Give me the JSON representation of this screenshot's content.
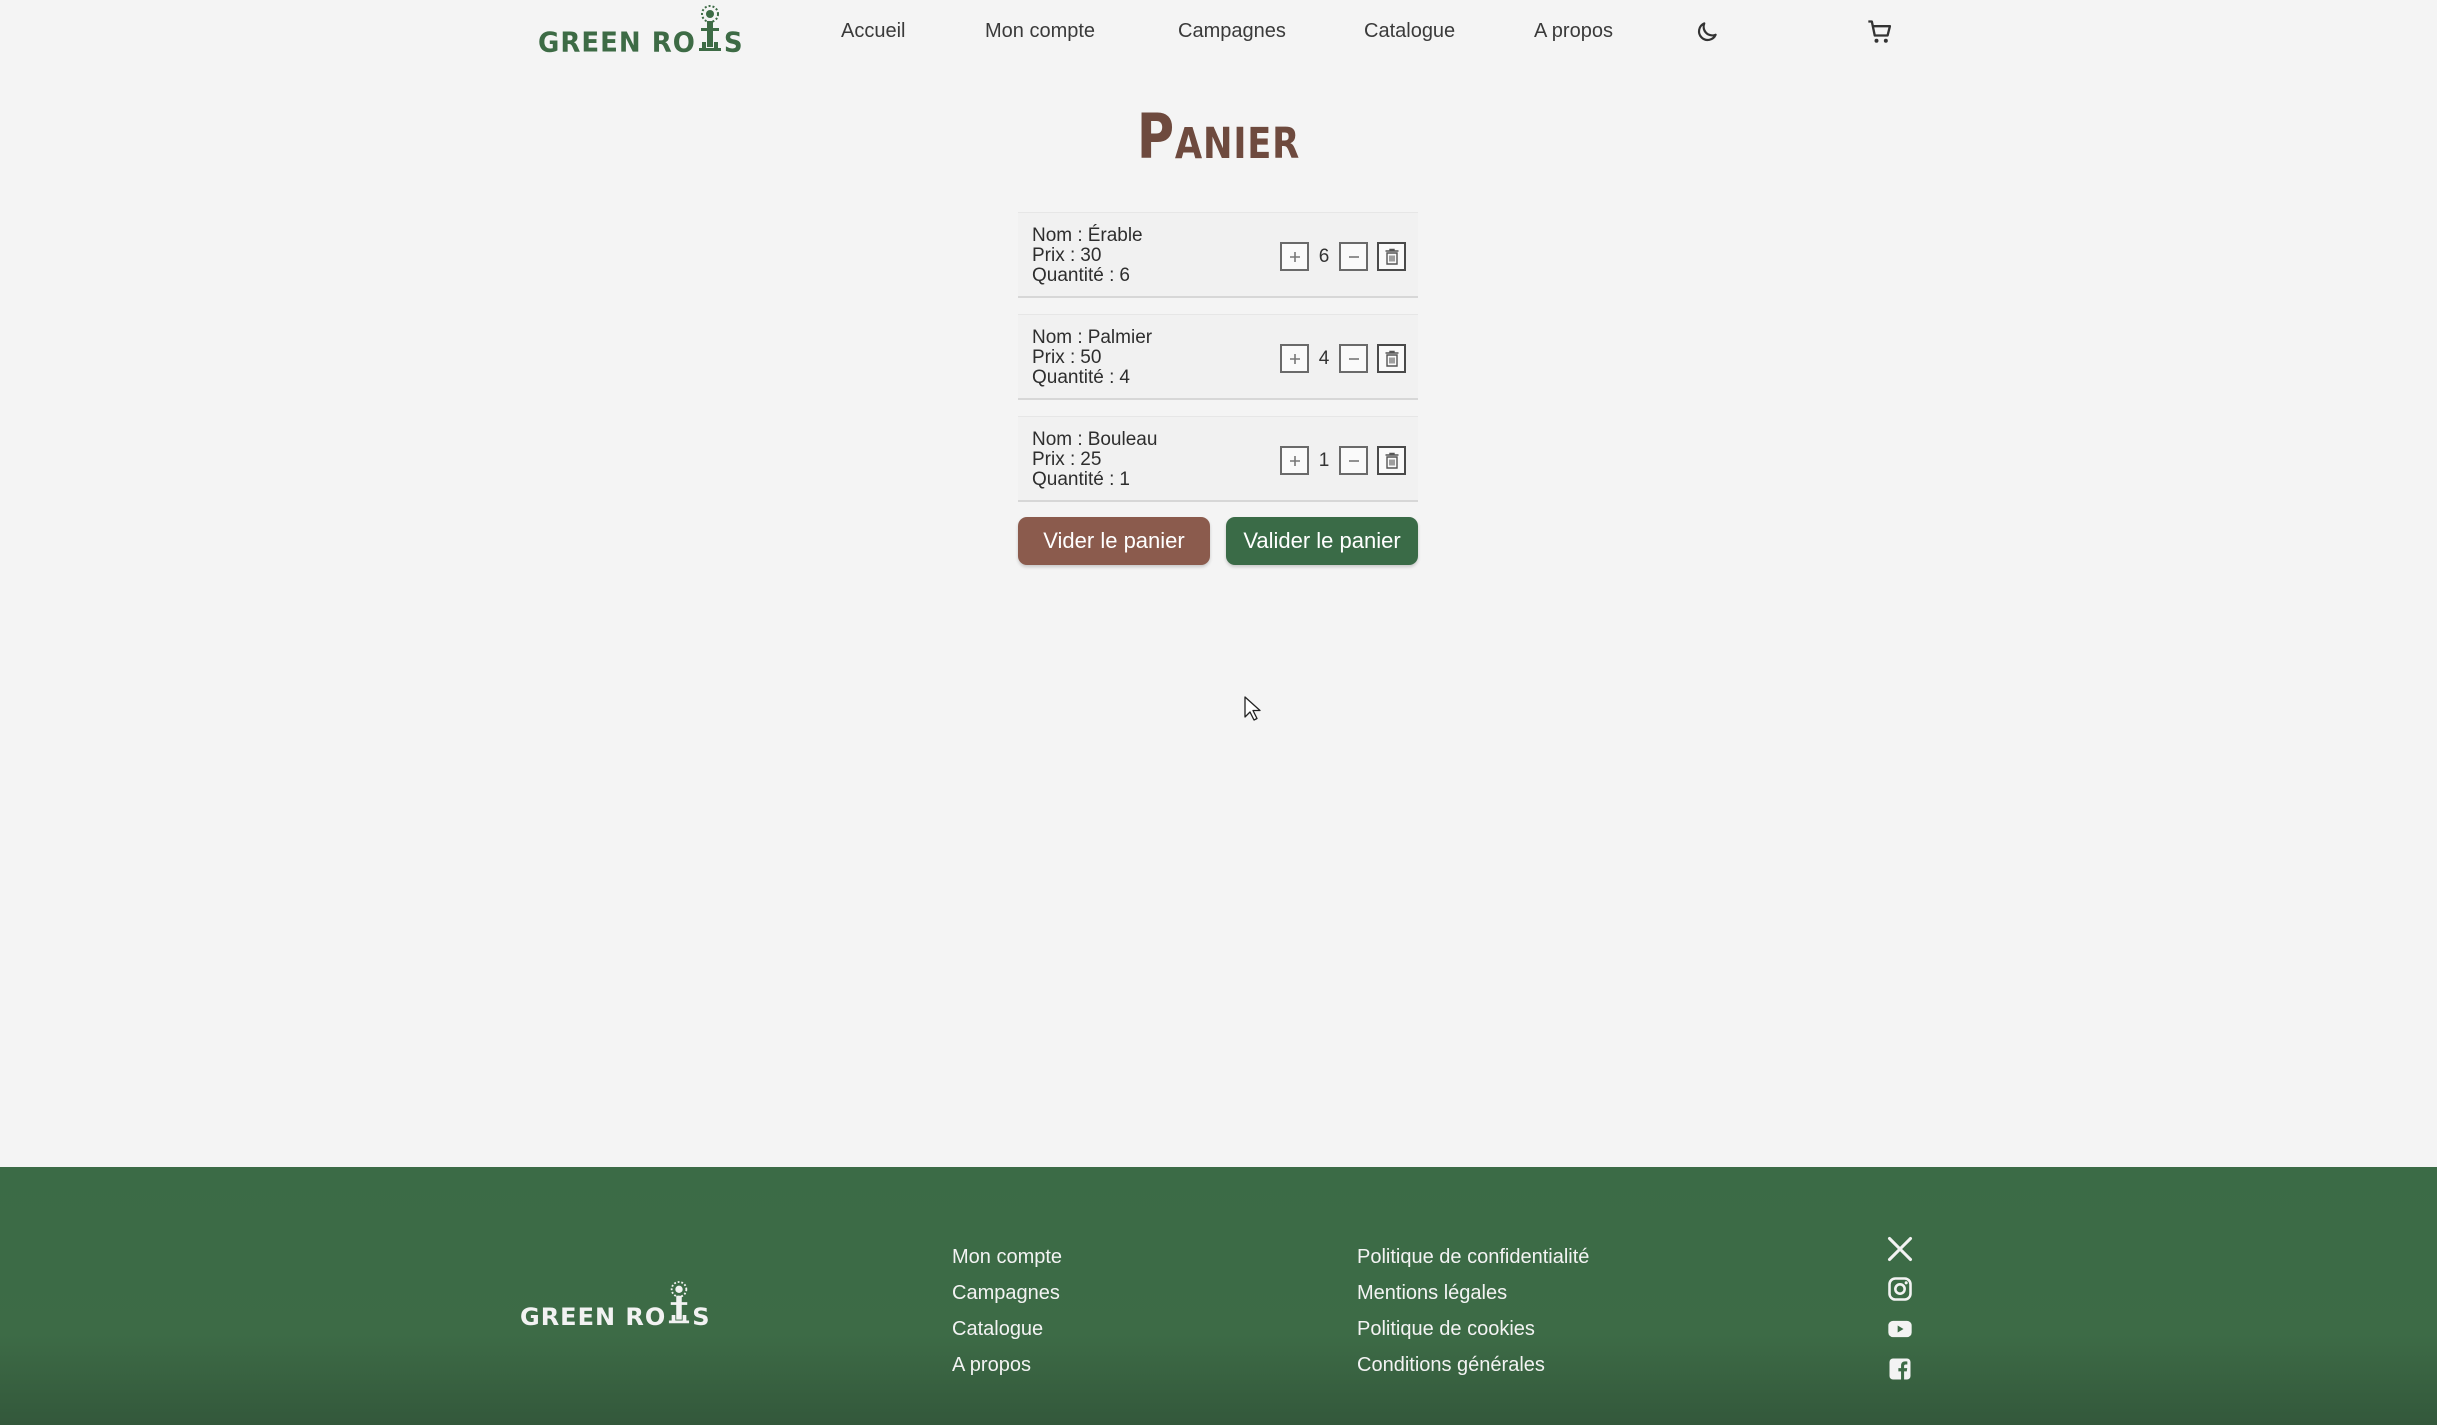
{
  "brand": {
    "name_left": "GREEN RO",
    "name_right": "S"
  },
  "nav": {
    "links": [
      "Accueil",
      "Mon compte",
      "Campagnes",
      "Catalogue",
      "A propos"
    ],
    "icons": [
      "moon-icon",
      "cart-icon"
    ]
  },
  "page": {
    "title": "Panier"
  },
  "cart": {
    "labels": {
      "name": "Nom :",
      "price": "Prix :",
      "quantity": "Quantité :"
    },
    "items": [
      {
        "name": "Érable",
        "price": "30",
        "quantity": "6"
      },
      {
        "name": "Palmier",
        "price": "50",
        "quantity": "4"
      },
      {
        "name": "Bouleau",
        "price": "25",
        "quantity": "1"
      }
    ],
    "controls": [
      "plus-icon",
      "minus-icon",
      "trash-icon"
    ]
  },
  "actions": {
    "empty_label": "Vider le panier",
    "validate_label": "Valider le panier"
  },
  "footer": {
    "col1": [
      "Mon compte",
      "Campagnes",
      "Catalogue",
      "A propos"
    ],
    "col2": [
      "Politique de confidentialité",
      "Mentions légales",
      "Politique de cookies",
      "Conditions générales"
    ],
    "social": [
      "x-icon",
      "instagram-icon",
      "youtube-icon",
      "facebook-icon"
    ]
  },
  "colors": {
    "primary_green": "#3a6b47",
    "brown": "#8b5b4d",
    "title_brown": "#6e4a3e",
    "background": "#f4f4f4",
    "footer_bg": "#3d6b46"
  }
}
